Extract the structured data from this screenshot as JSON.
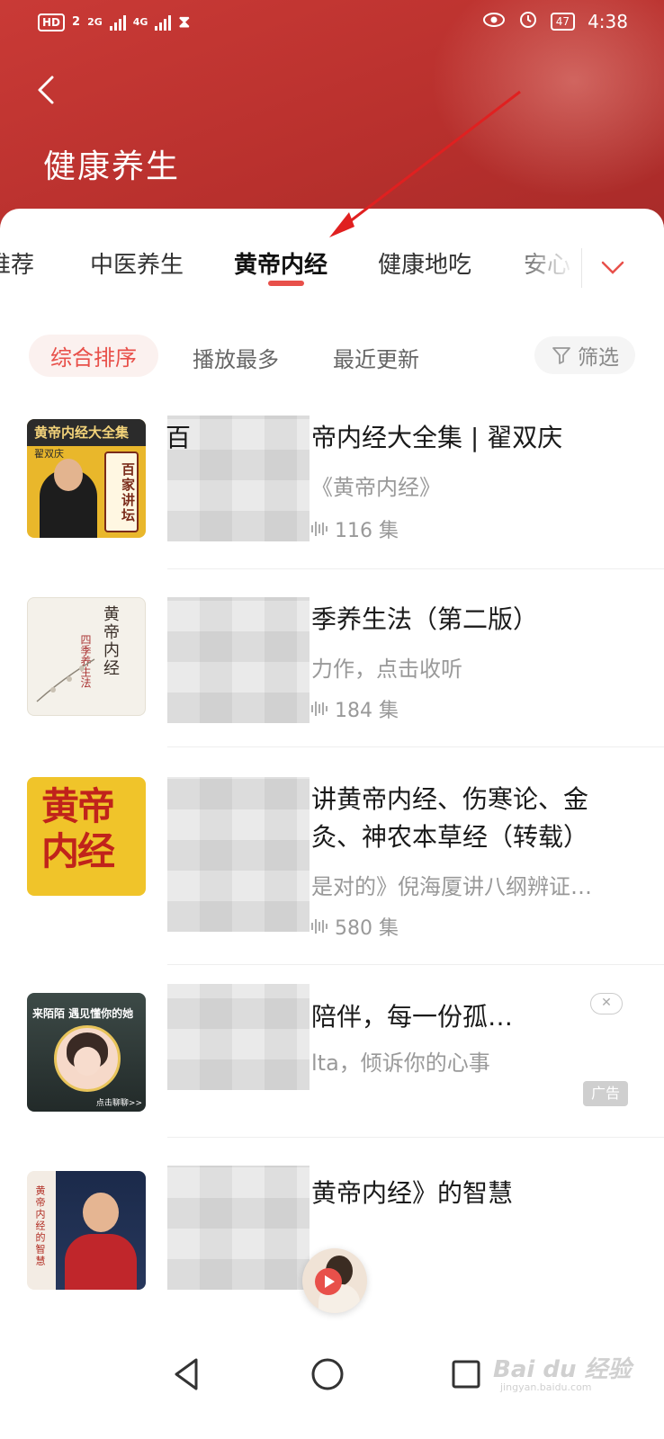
{
  "status_bar": {
    "hd": "HD",
    "sim": "2",
    "net1": "2G",
    "net2": "4G",
    "battery": "47",
    "time": "4:38"
  },
  "header": {
    "title": "健康养生"
  },
  "tabs": [
    {
      "label": "推荐"
    },
    {
      "label": "中医养生"
    },
    {
      "label": "黄帝内经"
    },
    {
      "label": "健康地吃"
    },
    {
      "label": "安心"
    }
  ],
  "sort": {
    "options": [
      "综合排序",
      "播放最多",
      "最近更新"
    ],
    "filter_label": "筛选"
  },
  "items": [
    {
      "cover_title": "黄帝内经大全集",
      "cover_author": "翟双庆",
      "cover_badge": "百家讲坛",
      "title": "帝内经大全集 | 翟双庆",
      "title_lead": "百",
      "sub": "《黄帝内经》",
      "episodes": "116 集"
    },
    {
      "cover_title": "黄帝内经",
      "cover_sub": "四季养生法",
      "title": "季养生法（第二版）",
      "sub": "力作，点击收听",
      "episodes": "184 集"
    },
    {
      "cover_title": "黄帝内经",
      "title_line1": "讲黄帝内经、伤寒论、金",
      "title_line2": "灸、神农本草经（转载）",
      "sub": "是对的》倪海厦讲八纲辨证…",
      "episodes": "580 集"
    },
    {
      "cover_top": "来陌陌  遇见懂你的她",
      "cover_bottom": "点击聊聊>>",
      "title": "陪伴，每一份孤…",
      "sub": "lta，倾诉你的心事",
      "ad_tag": "广告",
      "close": "✕"
    },
    {
      "cover_side": "黄帝内经的智慧",
      "title": "黄帝内经》的智慧"
    }
  ],
  "watermark": {
    "brand": "Bai du 经验",
    "url": "jingyan.baidu.com"
  },
  "colors": {
    "header_red": "#c93a36",
    "accent": "#e8504a"
  }
}
